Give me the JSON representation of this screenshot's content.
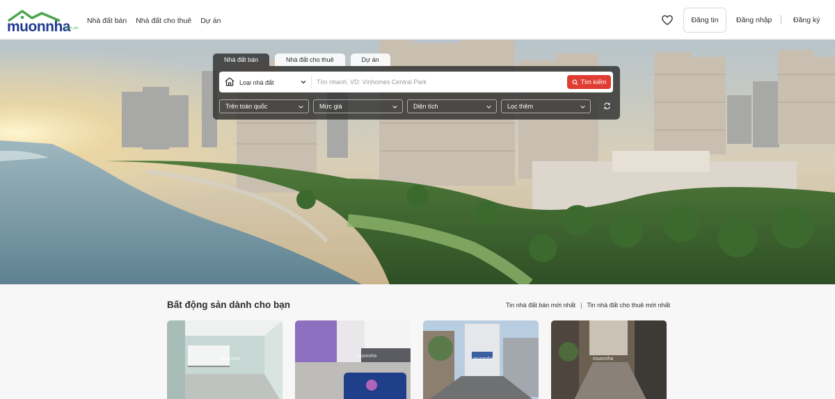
{
  "header": {
    "logo_text": "muonnha",
    "logo_sub": ".com.vn",
    "nav": [
      "Nhà đất bán",
      "Nhà đất cho thuê",
      "Dự án"
    ],
    "favorite_icon": "heart-icon",
    "post_button": "Đăng tin",
    "login": "Đăng nhập",
    "register": "Đăng ký"
  },
  "search": {
    "tabs": [
      "Nhà đất bán",
      "Nhà đất cho thuê",
      "Dự án"
    ],
    "active_tab": "Nhà đất bán",
    "property_type": "Loại nhà đất",
    "placeholder": "Tìm nhanh. VD: Vinhomes Central Park",
    "search_button": "Tìm kiếm",
    "filters": [
      "Trên toàn quốc",
      "Mức giá",
      "Diện tích",
      "Lọc thêm"
    ]
  },
  "listings": {
    "title": "Bất động sản dành cho bạn",
    "link_sale": "Tin nhà đất bán mới nhất",
    "link_divider": "|",
    "link_rent": "Tin nhà đất cho thuê mới nhất",
    "watermark": "muonnha"
  },
  "colors": {
    "brand_blue": "#1f3a8f",
    "brand_green": "#4aa54a",
    "accent_red": "#e03c31"
  }
}
